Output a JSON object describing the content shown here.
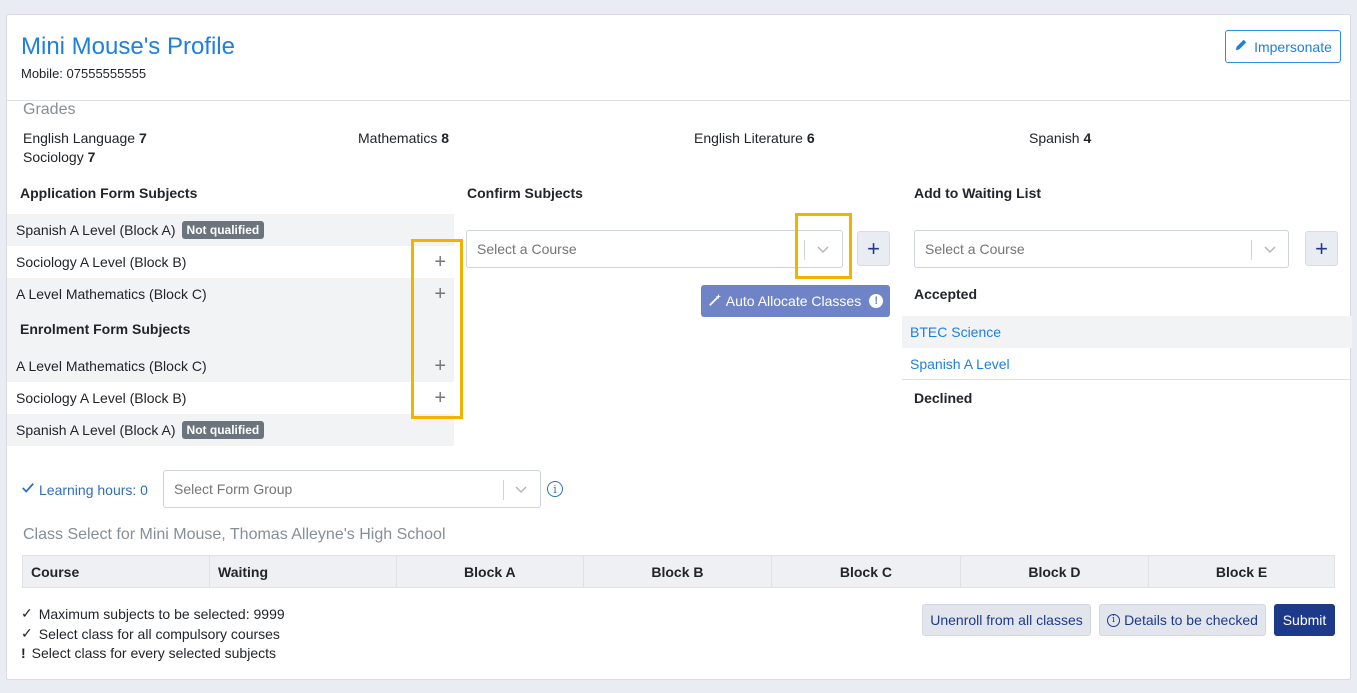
{
  "header": {
    "title": "Mini Mouse's Profile",
    "mobile": "Mobile: 07555555555",
    "impersonate_label": "Impersonate"
  },
  "grades": {
    "title": "Grades",
    "items": [
      {
        "subject": "English Language",
        "grade": "7"
      },
      {
        "subject": "Mathematics",
        "grade": "8"
      },
      {
        "subject": "English Literature",
        "grade": "6"
      },
      {
        "subject": "Spanish",
        "grade": "4"
      },
      {
        "subject": "Sociology",
        "grade": "7"
      }
    ]
  },
  "application_form": {
    "title": "Application Form Subjects",
    "rows": [
      {
        "label": "Spanish A Level (Block A)",
        "badge": "Not qualified"
      },
      {
        "label": "Sociology A Level (Block B)"
      },
      {
        "label": "A Level Mathematics (Block C)"
      }
    ]
  },
  "enrolment_form": {
    "title": "Enrolment Form Subjects",
    "rows": [
      {
        "label": "A Level Mathematics (Block C)"
      },
      {
        "label": "Sociology A Level (Block B)"
      },
      {
        "label": "Spanish A Level (Block A)",
        "badge": "Not qualified"
      }
    ]
  },
  "confirm_subjects": {
    "title": "Confirm Subjects",
    "select_placeholder": "Select a Course",
    "auto_allocate_label": "Auto Allocate Classes"
  },
  "waiting_list": {
    "title": "Add to Waiting List",
    "select_placeholder": "Select a Course",
    "accepted_title": "Accepted",
    "accepted": [
      "BTEC Science",
      "Spanish A Level"
    ],
    "declined_title": "Declined"
  },
  "learning": {
    "hours_label": "Learning hours: 0",
    "form_group_placeholder": "Select Form Group"
  },
  "class_select": {
    "title": "Class Select for Mini Mouse, Thomas Alleyne's High School",
    "columns": [
      "Course",
      "Waiting",
      "Block A",
      "Block B",
      "Block C",
      "Block D",
      "Block E"
    ]
  },
  "checks": [
    {
      "mark": "✓",
      "text": "Maximum subjects to be selected: 9999"
    },
    {
      "mark": "✓",
      "text": "Select class for all compulsory courses"
    },
    {
      "mark": "!",
      "text": "Select class for every selected subjects"
    }
  ],
  "actions": {
    "unenroll_label": "Unenroll from all classes",
    "details_label": "Details to be checked",
    "submit_label": "Submit"
  },
  "colors": {
    "brand_blue": "#1f7fe0",
    "primary_dark": "#1d3a8a",
    "highlight": "#f0b400",
    "badge_gray": "#6c757d"
  }
}
